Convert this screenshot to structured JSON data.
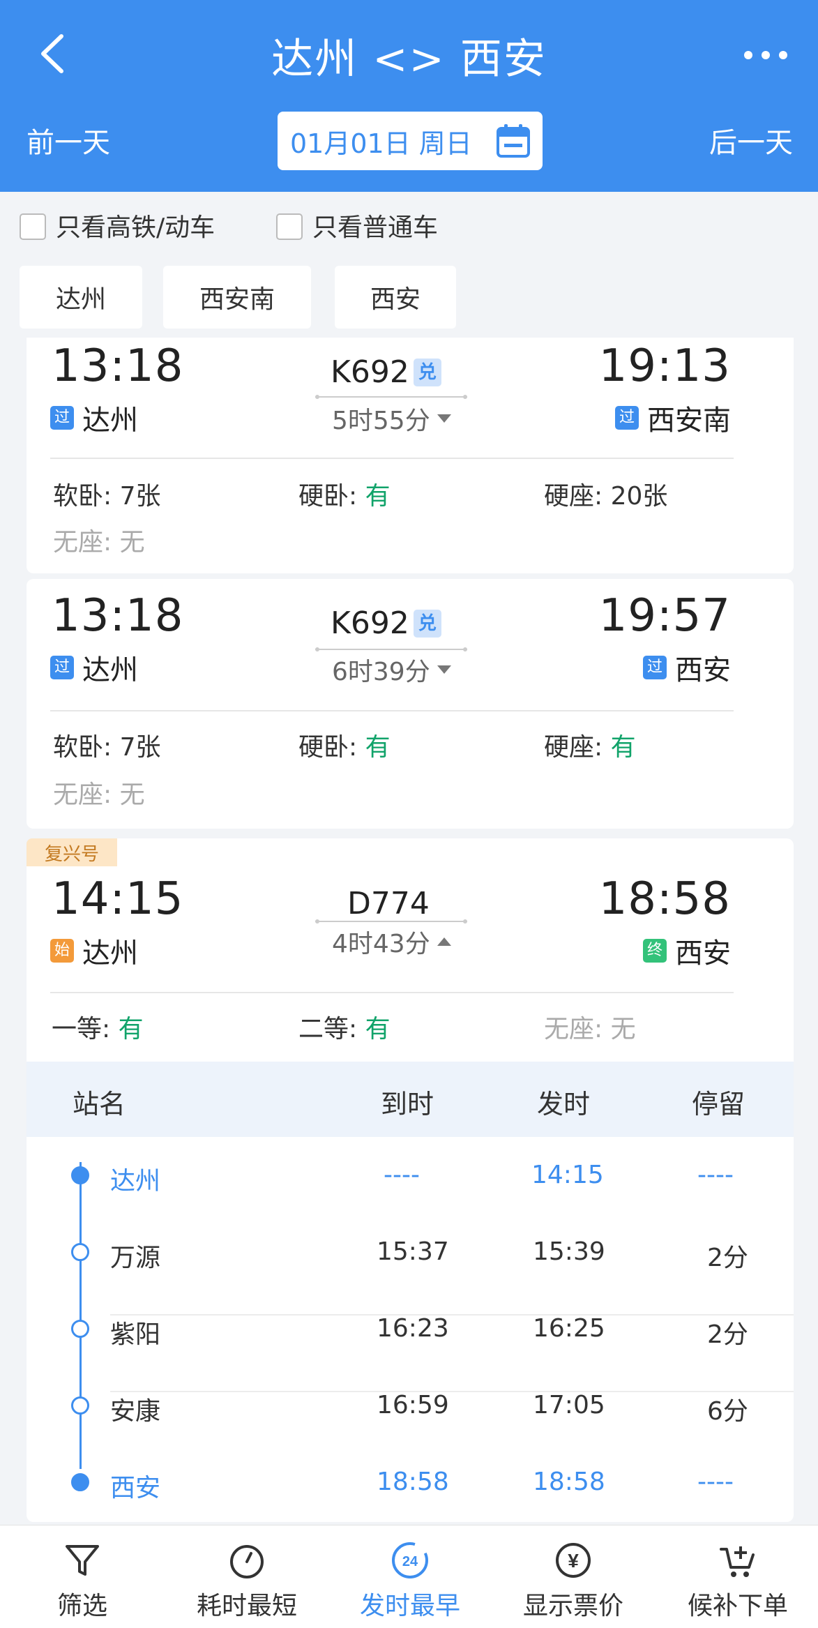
{
  "header": {
    "title": "达州 <> 西安",
    "prev_day": "前一天",
    "next_day": "后一天",
    "date": "01月01日 周日"
  },
  "filters": {
    "high_speed": "只看高铁/动车",
    "normal": "只看普通车",
    "stations": [
      "达州",
      "西安南",
      "西安"
    ]
  },
  "trains": [
    {
      "depart_time": "13:18",
      "depart_badge": "过",
      "depart_station": "达州",
      "train_no": "K692",
      "exchange_badge": "兑",
      "duration": "5时55分",
      "arrive_time": "19:13",
      "arrive_badge": "过",
      "arrive_station": "西安南",
      "seats": [
        {
          "label": "软卧: ",
          "value": "7张"
        },
        {
          "label": "硬卧: ",
          "value": "有"
        },
        {
          "label": "硬座: ",
          "value": "20张"
        },
        {
          "label": "无座: ",
          "value": "无"
        }
      ]
    },
    {
      "depart_time": "13:18",
      "depart_badge": "过",
      "depart_station": "达州",
      "train_no": "K692",
      "exchange_badge": "兑",
      "duration": "6时39分",
      "arrive_time": "19:57",
      "arrive_badge": "过",
      "arrive_station": "西安",
      "seats": [
        {
          "label": "软卧: ",
          "value": "7张"
        },
        {
          "label": "硬卧: ",
          "value": "有"
        },
        {
          "label": "硬座: ",
          "value": "有"
        },
        {
          "label": "无座: ",
          "value": "无"
        }
      ]
    },
    {
      "tag": "复兴号",
      "depart_time": "14:15",
      "depart_badge": "始",
      "depart_station": "达州",
      "train_no": "D774",
      "duration": "4时43分",
      "arrive_time": "18:58",
      "arrive_badge": "终",
      "arrive_station": "西安",
      "seats": [
        {
          "label": "一等: ",
          "value": "有"
        },
        {
          "label": "二等: ",
          "value": "有"
        },
        {
          "label": "无座: ",
          "value": "无"
        }
      ],
      "stop_table": {
        "headers": [
          "站名",
          "到时",
          "发时",
          "停留"
        ],
        "rows": [
          {
            "station": "达州",
            "arrive": "----",
            "depart": "14:15",
            "stay": "----"
          },
          {
            "station": "万源",
            "arrive": "15:37",
            "depart": "15:39",
            "stay": "2分"
          },
          {
            "station": "紫阳",
            "arrive": "16:23",
            "depart": "16:25",
            "stay": "2分"
          },
          {
            "station": "安康",
            "arrive": "16:59",
            "depart": "17:05",
            "stay": "6分"
          },
          {
            "station": "西安",
            "arrive": "18:58",
            "depart": "18:58",
            "stay": "----"
          }
        ]
      }
    }
  ],
  "bottom_bar": {
    "items": [
      {
        "label": "筛选",
        "icon": "filter-icon"
      },
      {
        "label": "耗时最短",
        "icon": "timer-icon"
      },
      {
        "label": "发时最早",
        "icon": "clock-24-icon",
        "icon_text": "24"
      },
      {
        "label": "显示票价",
        "icon": "yen-icon",
        "icon_text": "¥"
      },
      {
        "label": "候补下单",
        "icon": "cart-add-icon"
      }
    ],
    "active_index": 2
  },
  "colors": {
    "primary": "#3d8eef",
    "available": "#11a36a",
    "fuxing_tag": "#fde6c6"
  }
}
